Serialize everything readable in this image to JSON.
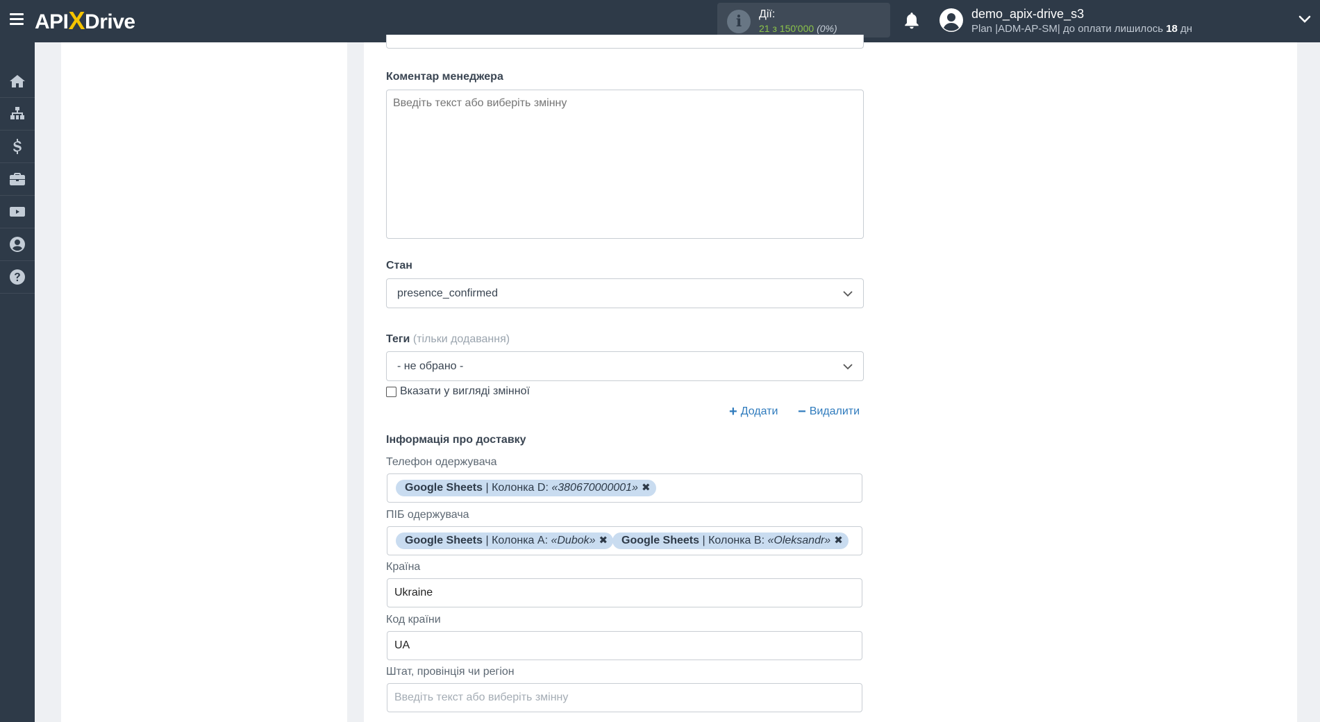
{
  "header": {
    "logo_left": "API",
    "logo_x": "X",
    "logo_right": "Drive",
    "actions": {
      "label": "Дії:",
      "count": "21",
      "of_text": "з 150'000",
      "percent": "(0%)"
    },
    "user": {
      "name": "demo_apix-drive_s3",
      "plan_prefix": "Plan |ADM-AP-SM| до оплати лишилось",
      "days": "18",
      "days_suffix": "дн"
    }
  },
  "sidebar": {
    "items": [
      {
        "icon": "home-icon"
      },
      {
        "icon": "sitemap-icon"
      },
      {
        "icon": "dollar-icon"
      },
      {
        "icon": "briefcase-icon"
      },
      {
        "icon": "youtube-icon"
      },
      {
        "icon": "user-circle-icon"
      },
      {
        "icon": "question-circle-icon"
      }
    ]
  },
  "form": {
    "manager_comment": {
      "label": "Коментар менеджера",
      "placeholder": "Введіть текст або виберіть змінну"
    },
    "status": {
      "label": "Стан",
      "value": "presence_confirmed"
    },
    "tags": {
      "label": "Теги",
      "sublabel": "(тільки додавання)",
      "value": "- не обрано -",
      "as_variable_label": "Вказати у вигляді змінної"
    },
    "add_label": "Додати",
    "remove_label": "Видалити",
    "delivery": {
      "section_title": "Інформація про доставку",
      "recipient_phone": {
        "label": "Телефон одержувача",
        "chips": [
          {
            "source": "Google Sheets",
            "column": "| Колонка D:",
            "value": "«380670000001»"
          }
        ]
      },
      "recipient_name": {
        "label": "ПІБ одержувача",
        "chips": [
          {
            "source": "Google Sheets",
            "column": "| Колонка A:",
            "value": "«Dubok»"
          },
          {
            "source": "Google Sheets",
            "column": "| Колонка B:",
            "value": "«Oleksandr»"
          }
        ]
      },
      "country": {
        "label": "Країна",
        "value": "Ukraine"
      },
      "country_code": {
        "label": "Код країни",
        "value": "UA"
      },
      "region": {
        "label": "Штат, провінція чи регіон",
        "placeholder": "Введіть текст або виберіть змінну"
      }
    }
  },
  "colors": {
    "topbar": "#2e3a48",
    "accent_yellow": "#f5c400",
    "chip_bg": "#c9dcf0",
    "link_blue": "#2f7bbd",
    "actions_green": "#8bc34a"
  }
}
